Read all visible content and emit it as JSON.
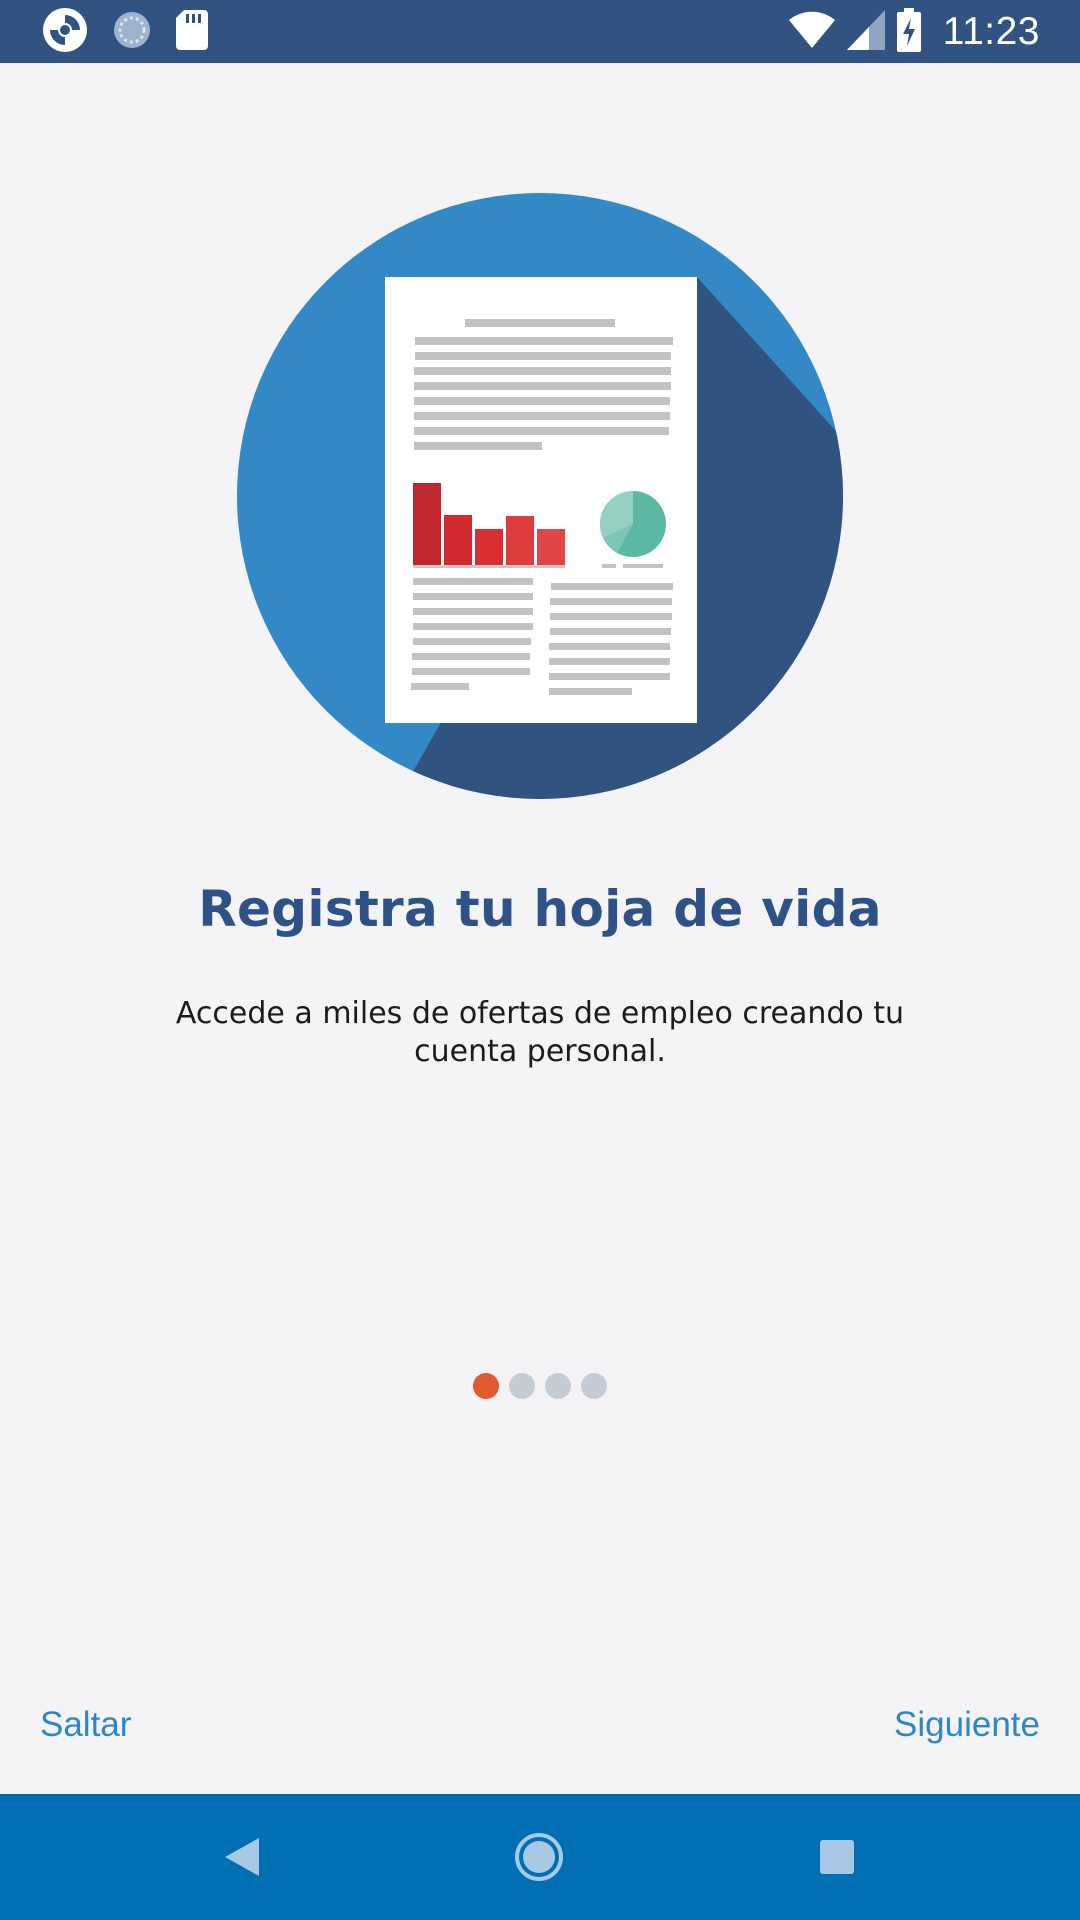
{
  "status_bar": {
    "time": "11:23",
    "left_icons": [
      "app-logo-icon",
      "sync-icon",
      "sd-card-icon"
    ],
    "right_icons": [
      "wifi-icon",
      "cell-signal-icon",
      "battery-charging-icon"
    ]
  },
  "onboarding": {
    "illustration": "resume-document-icon",
    "title": "Registra tu hoja de vida",
    "subtitle": "Accede a miles de ofertas de empleo creando tu cuenta personal.",
    "pages_total": 4,
    "current_page": 1
  },
  "actions": {
    "skip_label": "Saltar",
    "next_label": "Siguiente"
  },
  "navigation_bar": {
    "buttons": [
      "back-icon",
      "home-icon",
      "recents-icon"
    ]
  },
  "colors": {
    "status_bar": "#315381",
    "nav_bar": "#006eb3",
    "title": "#2e5285",
    "accent": "#2f86c5",
    "active_dot": "#e4582f",
    "inactive_dot": "#c5ccd4"
  }
}
